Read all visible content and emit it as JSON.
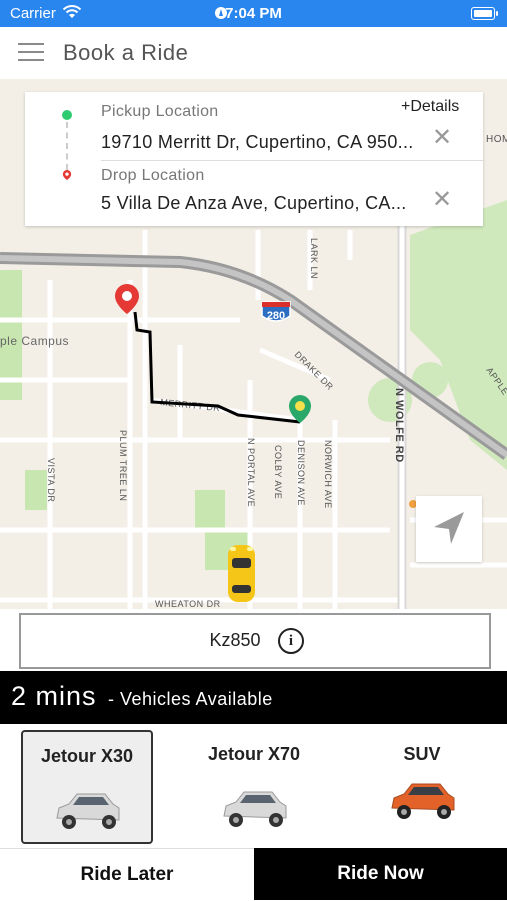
{
  "status_bar": {
    "carrier": "Carrier",
    "time": "7:04 PM"
  },
  "header": {
    "title": "Book a Ride",
    "menu_icon": "hamburger-icon"
  },
  "location_card": {
    "pickup_label": "Pickup Location",
    "pickup_value": "19710 Merritt Dr, Cupertino, CA 950...",
    "drop_label": "Drop Location",
    "drop_value": "5 Villa De Anza Ave, Cupertino, CA...",
    "details_link": "+Details"
  },
  "map": {
    "labels": {
      "apple_campus": "ple Campus",
      "merritt": "MERRITT DR",
      "plum_tree": "PLUM TREE LN",
      "vista": "VISTA DR",
      "portal": "N PORTAL AVE",
      "colby": "COLBY AVE",
      "denison": "DENISON AVE",
      "norwich": "NORWICH AVE",
      "drake": "DRAKE DR",
      "lark": "LARK LN",
      "wolfe": "N WOLFE RD",
      "wheaton": "WHEATON DR",
      "apple": "APPLE",
      "hom": "HOM",
      "highway": "280"
    }
  },
  "promo": {
    "code": "Kz850",
    "info_icon": "info-icon"
  },
  "eta": {
    "time": "2 mins",
    "text": "- Vehicles Available"
  },
  "vehicles": [
    {
      "name": "Jetour X30",
      "selected": true,
      "color": "#d9d9d9"
    },
    {
      "name": "Jetour X70",
      "selected": false,
      "color": "#d9d9d9"
    },
    {
      "name": "SUV",
      "selected": false,
      "color": "#e2622a"
    }
  ],
  "actions": {
    "ride_later": "Ride Later",
    "ride_now": "Ride Now"
  },
  "colors": {
    "status_bar": "#2a86ef",
    "pickup_dot": "#2ecc71",
    "drop_pin": "#e53935",
    "route": "#000000",
    "taxi": "#f5c518"
  }
}
